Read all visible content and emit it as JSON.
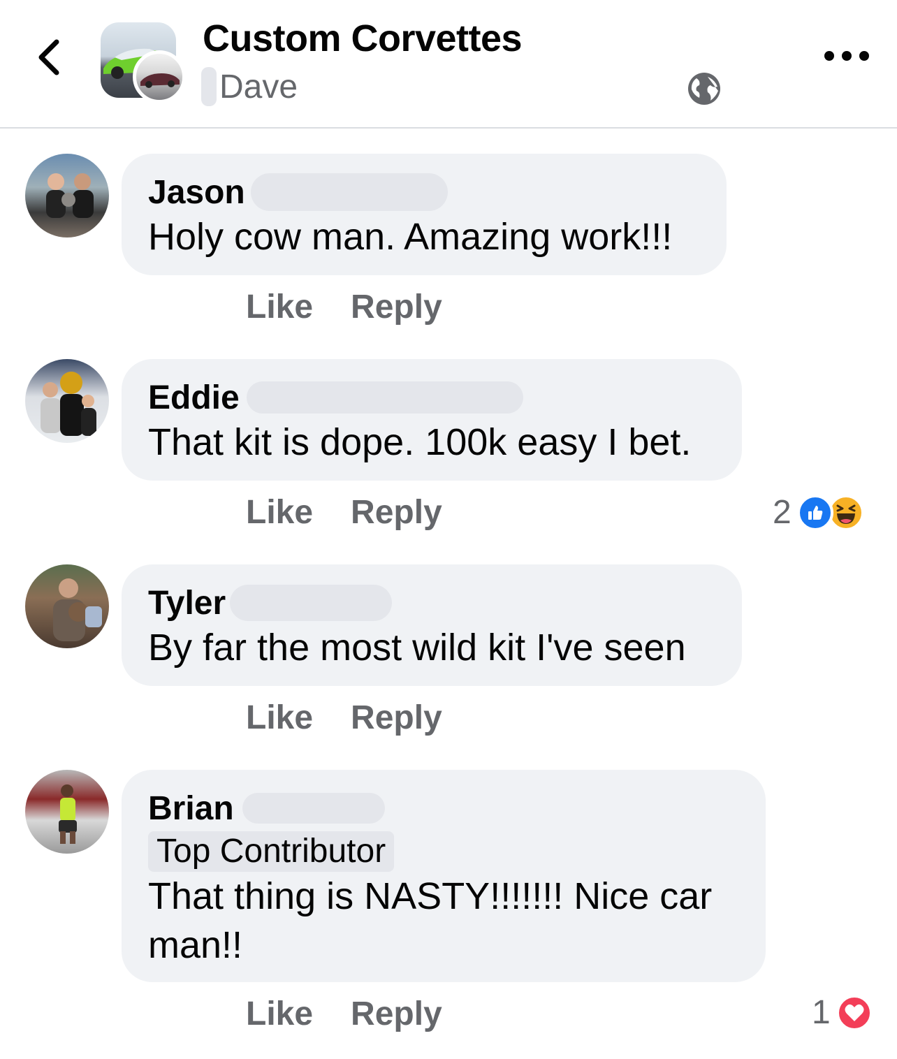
{
  "header": {
    "group_title": "Custom Corvettes",
    "author_name": "Dave"
  },
  "comments": [
    {
      "name": "Jason",
      "text": "Holy cow man. Amazing work!!!",
      "like_label": "Like",
      "reply_label": "Reply"
    },
    {
      "name": "Eddie",
      "text": "That kit is dope. 100k easy I bet.",
      "like_label": "Like",
      "reply_label": "Reply",
      "reaction_count": "2",
      "reactions": [
        "like-icon",
        "haha-icon"
      ]
    },
    {
      "name": "Tyler",
      "text": "By far the most wild kit I've seen",
      "like_label": "Like",
      "reply_label": "Reply"
    },
    {
      "name": "Brian",
      "badge": "Top Contributor",
      "text_line1": "That thing is NASTY!!!!!!! Nice car",
      "text_line2": "man!!",
      "like_label": "Like",
      "reply_label": "Reply",
      "reaction_count": "1",
      "reactions": [
        "love-icon"
      ]
    }
  ],
  "colors": {
    "bubble": "#f0f2f5",
    "muted_text": "#65676b",
    "like_blue": "#1877f2",
    "love_red": "#f33e58",
    "haha_yellow": "#f7b125"
  }
}
